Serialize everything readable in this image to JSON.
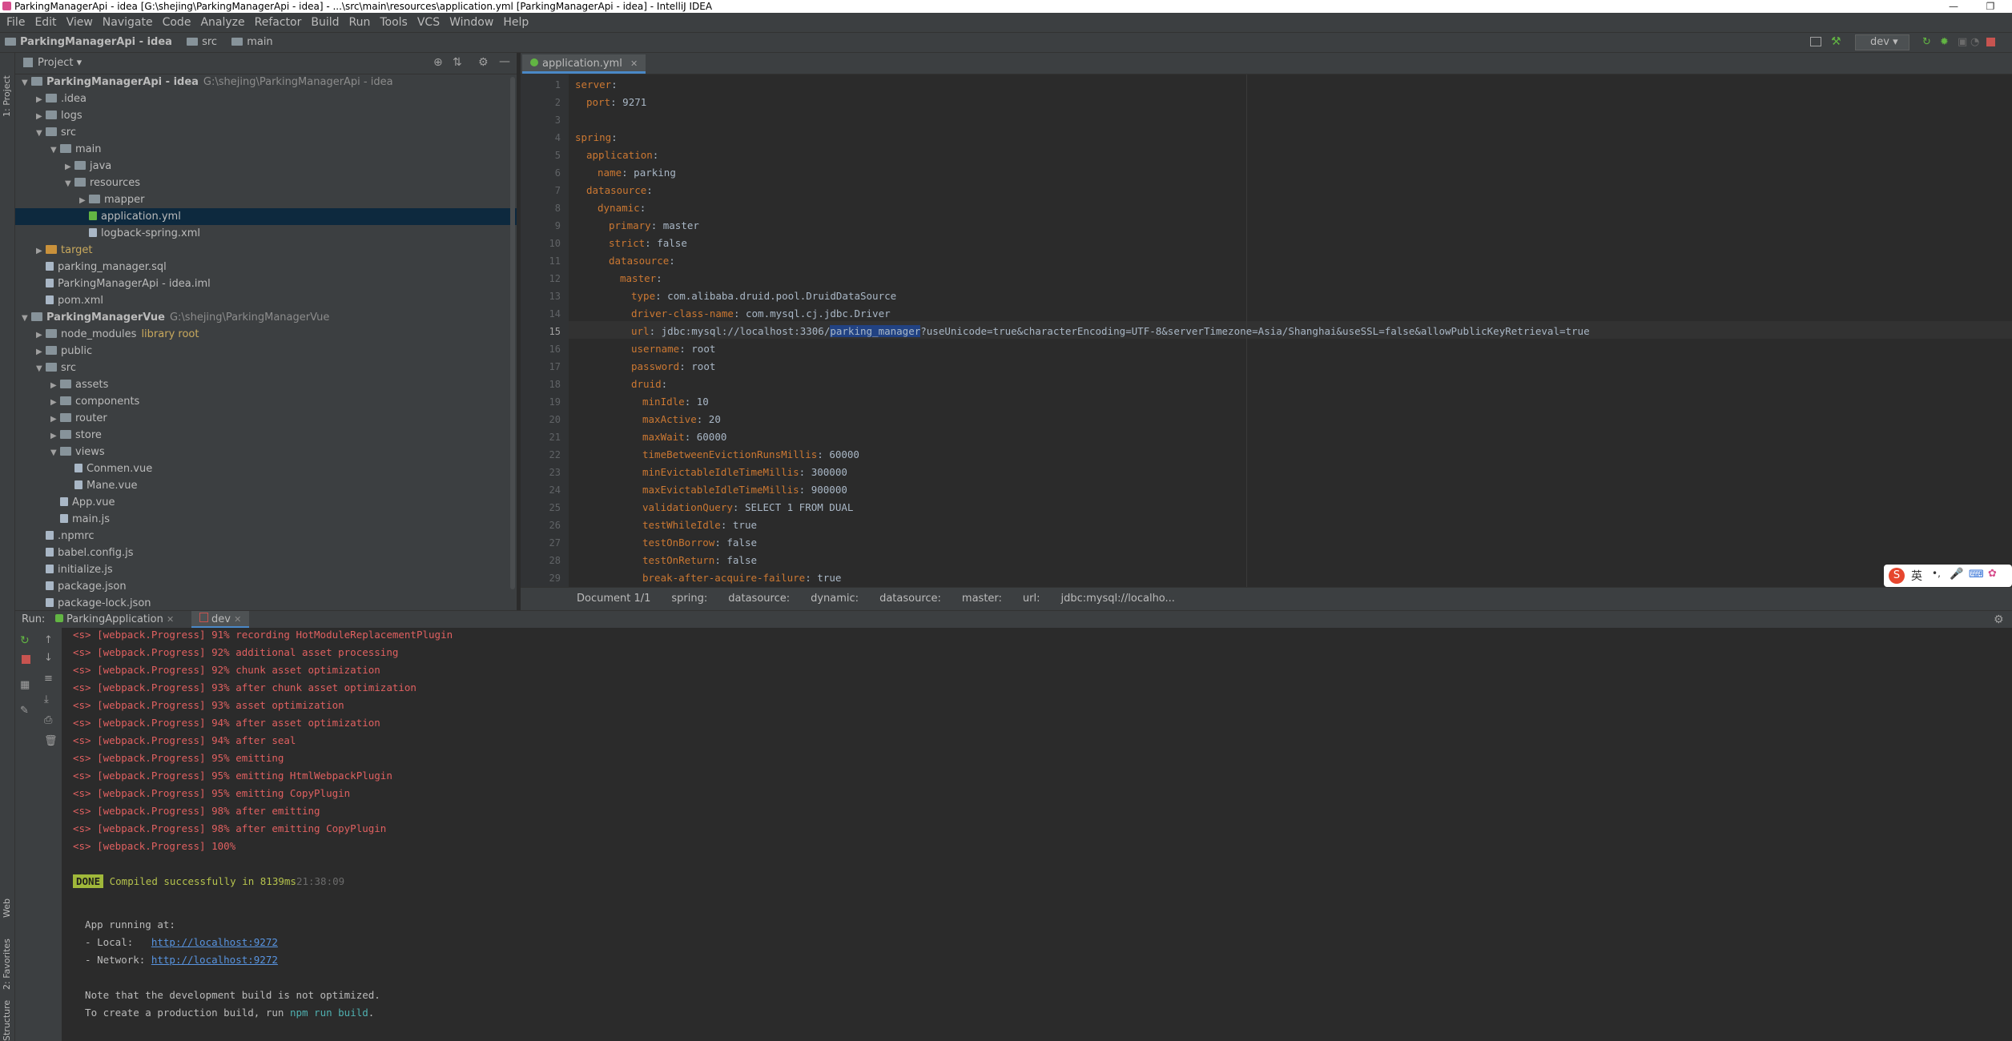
{
  "window": {
    "title": "ParkingManagerApi - idea [G:\\shejing\\ParkingManagerApi - idea] - ...\\src\\main\\resources\\application.yml [ParkingManagerApi - idea] - IntelliJ IDEA",
    "minimize": "—",
    "maximize": "❐"
  },
  "menu": [
    "File",
    "Edit",
    "View",
    "Navigate",
    "Code",
    "Analyze",
    "Refactor",
    "Build",
    "Run",
    "Tools",
    "VCS",
    "Window",
    "Help"
  ],
  "navbar": {
    "crumbs": [
      "ParkingManagerApi - idea",
      "src",
      "main"
    ],
    "run_config": "dev"
  },
  "project_panel": {
    "title": "Project",
    "tree": [
      {
        "label": "ParkingManagerApi - idea",
        "hint": "G:\\shejing\\ParkingManagerApi - idea",
        "depth": 0,
        "arrow": "▼",
        "bold": true,
        "type": "dir"
      },
      {
        "label": ".idea",
        "depth": 1,
        "arrow": "▶",
        "type": "dir"
      },
      {
        "label": "logs",
        "depth": 1,
        "arrow": "▶",
        "type": "dir"
      },
      {
        "label": "src",
        "depth": 1,
        "arrow": "▼",
        "type": "dir"
      },
      {
        "label": "main",
        "depth": 2,
        "arrow": "▼",
        "type": "dir"
      },
      {
        "label": "java",
        "depth": 3,
        "arrow": "▶",
        "type": "dir"
      },
      {
        "label": "resources",
        "depth": 3,
        "arrow": "▼",
        "type": "dir"
      },
      {
        "label": "mapper",
        "depth": 4,
        "arrow": "▶",
        "type": "dir"
      },
      {
        "label": "application.yml",
        "depth": 4,
        "arrow": "",
        "type": "file",
        "selected": true
      },
      {
        "label": "logback-spring.xml",
        "depth": 4,
        "arrow": "",
        "type": "file"
      },
      {
        "label": "target",
        "depth": 1,
        "arrow": "▶",
        "type": "dir",
        "orange": true
      },
      {
        "label": "parking_manager.sql",
        "depth": 1,
        "arrow": "",
        "type": "file"
      },
      {
        "label": "ParkingManagerApi - idea.iml",
        "depth": 1,
        "arrow": "",
        "type": "file"
      },
      {
        "label": "pom.xml",
        "depth": 1,
        "arrow": "",
        "type": "file"
      },
      {
        "label": "ParkingManagerVue",
        "hint": "G:\\shejing\\ParkingManagerVue",
        "depth": 0,
        "arrow": "▼",
        "bold": true,
        "type": "dir"
      },
      {
        "label": "node_modules",
        "hint": "library root",
        "depth": 1,
        "arrow": "▶",
        "type": "dir",
        "lib": true
      },
      {
        "label": "public",
        "depth": 1,
        "arrow": "▶",
        "type": "dir"
      },
      {
        "label": "src",
        "depth": 1,
        "arrow": "▼",
        "type": "dir"
      },
      {
        "label": "assets",
        "depth": 2,
        "arrow": "▶",
        "type": "dir"
      },
      {
        "label": "components",
        "depth": 2,
        "arrow": "▶",
        "type": "dir"
      },
      {
        "label": "router",
        "depth": 2,
        "arrow": "▶",
        "type": "dir"
      },
      {
        "label": "store",
        "depth": 2,
        "arrow": "▶",
        "type": "dir"
      },
      {
        "label": "views",
        "depth": 2,
        "arrow": "▼",
        "type": "dir"
      },
      {
        "label": "Conmen.vue",
        "depth": 3,
        "arrow": "",
        "type": "file"
      },
      {
        "label": "Mane.vue",
        "depth": 3,
        "arrow": "",
        "type": "file"
      },
      {
        "label": "App.vue",
        "depth": 2,
        "arrow": "",
        "type": "file"
      },
      {
        "label": "main.js",
        "depth": 2,
        "arrow": "",
        "type": "file"
      },
      {
        "label": ".npmrc",
        "depth": 1,
        "arrow": "",
        "type": "file"
      },
      {
        "label": "babel.config.js",
        "depth": 1,
        "arrow": "",
        "type": "file"
      },
      {
        "label": "initialize.js",
        "depth": 1,
        "arrow": "",
        "type": "file"
      },
      {
        "label": "package.json",
        "depth": 1,
        "arrow": "",
        "type": "file"
      },
      {
        "label": "package-lock.json",
        "depth": 1,
        "arrow": "",
        "type": "file"
      }
    ]
  },
  "editor": {
    "tab": "application.yml",
    "lines": [
      {
        "n": "1",
        "indent": 0,
        "key": "server",
        "val": ""
      },
      {
        "n": "2",
        "indent": 1,
        "key": "port",
        "val": "9271"
      },
      {
        "n": "3",
        "indent": 0,
        "key": "",
        "val": ""
      },
      {
        "n": "4",
        "indent": 0,
        "key": "spring",
        "val": ""
      },
      {
        "n": "5",
        "indent": 1,
        "key": "application",
        "val": ""
      },
      {
        "n": "6",
        "indent": 2,
        "key": "name",
        "val": "parking"
      },
      {
        "n": "7",
        "indent": 1,
        "key": "datasource",
        "val": ""
      },
      {
        "n": "8",
        "indent": 2,
        "key": "dynamic",
        "val": ""
      },
      {
        "n": "9",
        "indent": 3,
        "key": "primary",
        "val": "master"
      },
      {
        "n": "10",
        "indent": 3,
        "key": "strict",
        "val": "false"
      },
      {
        "n": "11",
        "indent": 3,
        "key": "datasource",
        "val": ""
      },
      {
        "n": "12",
        "indent": 4,
        "key": "master",
        "val": ""
      },
      {
        "n": "13",
        "indent": 5,
        "key": "type",
        "val": "com.alibaba.druid.pool.DruidDataSource"
      },
      {
        "n": "14",
        "indent": 5,
        "key": "driver-class-name",
        "val": "com.mysql.cj.jdbc.Driver"
      },
      {
        "n": "15",
        "indent": 5,
        "key": "url",
        "val_pre": "jdbc:mysql://localhost:3306/",
        "val_sel": "parking_manager",
        "val_post": "?useUnicode=true&characterEncoding=UTF-8&serverTimezone=Asia/Shanghai&useSSL=false&allowPublicKeyRetrieval=true"
      },
      {
        "n": "16",
        "indent": 5,
        "key": "username",
        "val": "root"
      },
      {
        "n": "17",
        "indent": 5,
        "key": "password",
        "val": "root"
      },
      {
        "n": "18",
        "indent": 5,
        "key": "druid",
        "val": ""
      },
      {
        "n": "19",
        "indent": 6,
        "key": "minIdle",
        "val": "10"
      },
      {
        "n": "20",
        "indent": 6,
        "key": "maxActive",
        "val": "20"
      },
      {
        "n": "21",
        "indent": 6,
        "key": "maxWait",
        "val": "60000"
      },
      {
        "n": "22",
        "indent": 6,
        "key": "timeBetweenEvictionRunsMillis",
        "val": "60000"
      },
      {
        "n": "23",
        "indent": 6,
        "key": "minEvictableIdleTimeMillis",
        "val": "300000"
      },
      {
        "n": "24",
        "indent": 6,
        "key": "maxEvictableIdleTimeMillis",
        "val": "900000"
      },
      {
        "n": "25",
        "indent": 6,
        "key": "validationQuery",
        "val": "SELECT 1 FROM DUAL"
      },
      {
        "n": "26",
        "indent": 6,
        "key": "testWhileIdle",
        "val": "true"
      },
      {
        "n": "27",
        "indent": 6,
        "key": "testOnBorrow",
        "val": "false"
      },
      {
        "n": "28",
        "indent": 6,
        "key": "testOnReturn",
        "val": "false"
      },
      {
        "n": "29",
        "indent": 6,
        "key": "break-after-acquire-failure",
        "val": "true"
      }
    ],
    "breadcrumb": [
      "Document 1/1",
      "spring:",
      "datasource:",
      "dynamic:",
      "datasource:",
      "master:",
      "url:",
      "jdbc:mysql://localho..."
    ]
  },
  "run_panel": {
    "label": "Run:",
    "tabs": [
      "ParkingApplication",
      "dev"
    ],
    "progress_lines": [
      "<s> [webpack.Progress] 91% recording HotModuleReplacementPlugin",
      "<s> [webpack.Progress] 92% additional asset processing",
      "<s> [webpack.Progress] 92% chunk asset optimization",
      "<s> [webpack.Progress] 93% after chunk asset optimization",
      "<s> [webpack.Progress] 93% asset optimization",
      "<s> [webpack.Progress] 94% after asset optimization",
      "<s> [webpack.Progress] 94% after seal",
      "<s> [webpack.Progress] 95% emitting",
      "<s> [webpack.Progress] 95% emitting HtmlWebpackPlugin",
      "<s> [webpack.Progress] 95% emitting CopyPlugin",
      "<s> [webpack.Progress] 98% after emitting",
      "<s> [webpack.Progress] 98% after emitting CopyPlugin",
      "<s> [webpack.Progress] 100%"
    ],
    "done_badge": "DONE",
    "done_text": "Compiled successfully in 8139ms",
    "done_time": "21:38:09",
    "app_running": "App running at:",
    "local_label": "- Local:   ",
    "local_url": "http://localhost:9272",
    "network_label": "- Network: ",
    "network_url": "http://localhost:9272",
    "note1": "Note that the development build is not optimized.",
    "note2_pre": "To create a production build, run ",
    "note2_cmd": "npm run build",
    "note2_post": "."
  },
  "left_stripe": {
    "project": "1: Project",
    "web": "Web",
    "favorites": "2: Favorites",
    "structure": "Structure"
  },
  "ime": {
    "label": "英"
  }
}
